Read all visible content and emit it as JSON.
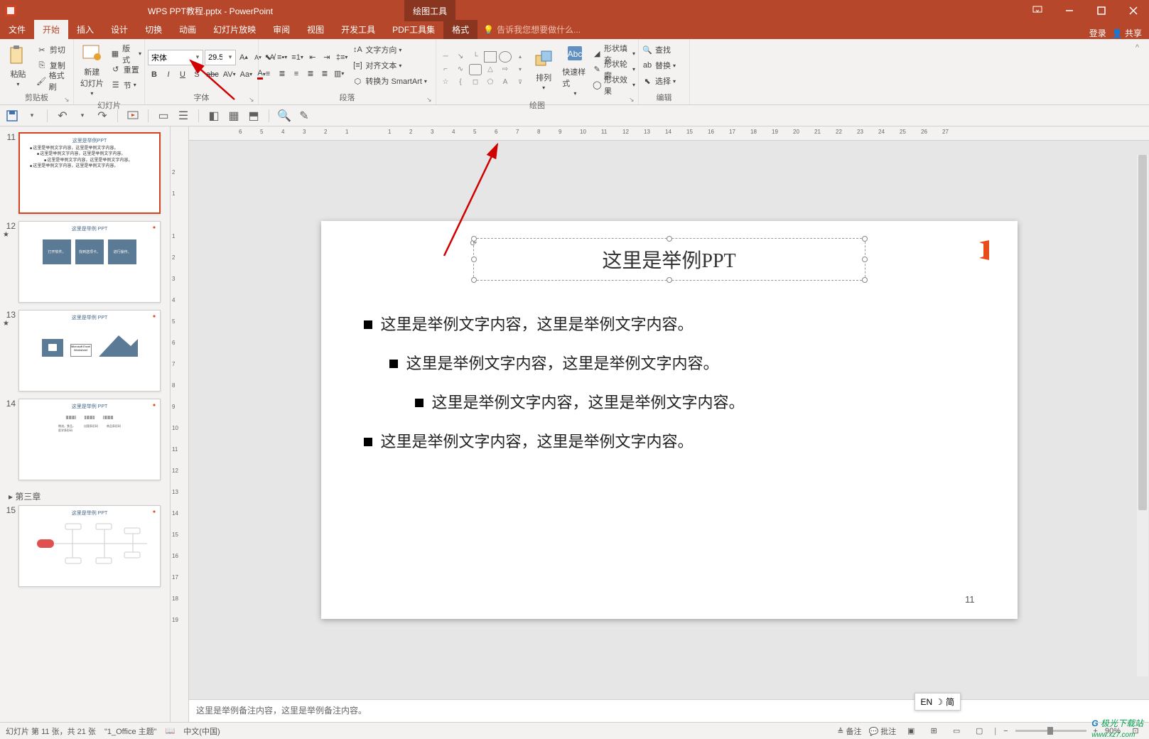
{
  "titlebar": {
    "title": "WPS PPT教程.pptx - PowerPoint",
    "drawing_tools": "绘图工具"
  },
  "menu": {
    "file": "文件",
    "home": "开始",
    "insert": "插入",
    "design": "设计",
    "transition": "切换",
    "animation": "动画",
    "slideshow": "幻灯片放映",
    "review": "审阅",
    "view": "视图",
    "dev": "开发工具",
    "pdf": "PDF工具集",
    "format": "格式",
    "tellme": "告诉我您想要做什么...",
    "login": "登录",
    "share": "共享"
  },
  "ribbon": {
    "clipboard": {
      "paste": "粘贴",
      "cut": "剪切",
      "copy": "复制",
      "fmt": "格式刷",
      "label": "剪贴板"
    },
    "slides": {
      "new": "新建\n幻灯片",
      "layout": "版式",
      "reset": "重置",
      "section": "节",
      "label": "幻灯片"
    },
    "font": {
      "name": "宋体",
      "size": "29.5",
      "label": "字体"
    },
    "para": {
      "label": "段落",
      "textdir": "文字方向",
      "align": "对齐文本",
      "smart": "转换为 SmartArt"
    },
    "draw": {
      "arrange": "排列",
      "quick": "快速样式",
      "fill": "形状填充",
      "outline": "形状轮廓",
      "effect": "形状效果",
      "label": "绘图"
    },
    "edit": {
      "find": "查找",
      "replace": "替换",
      "select": "选择",
      "label": "编辑"
    }
  },
  "thumbs": {
    "t11": {
      "num": "11",
      "title": "这里是举例PPT",
      "lines": [
        "这里是举例文字内容，这里是举例文字内容。",
        "这里是举例文字内容，这里是举例文字内容。",
        "这里是举例文字内容，这里是举例文字内容。",
        "这里是举例文字内容，这里是举例文字内容。"
      ]
    },
    "t12": {
      "num": "12",
      "title": "这里是举例 PPT",
      "b1": "打开软件。",
      "b2": "找到选项卡。",
      "b3": "进行操作。"
    },
    "t13": {
      "num": "13",
      "title": "这里是举例 PPT"
    },
    "t14": {
      "num": "14",
      "title": "这里是举例 PPT"
    },
    "section": "第三章",
    "t15": {
      "num": "15",
      "title": "这里是举例 PPT"
    }
  },
  "slide": {
    "title": "这里是举例PPT",
    "bullets": [
      "这里是举例文字内容，这里是举例文字内容。",
      "这里是举例文字内容，这里是举例文字内容。",
      "这里是举例文字内容，这里是举例文字内容。",
      "这里是举例文字内容，这里是举例文字内容。"
    ],
    "number": "11"
  },
  "notes": "这里是举例备注内容，这里是举例备注内容。",
  "status": {
    "slide": "幻灯片 第 11 张，共 21 张",
    "theme": "\"1_Office 主题\"",
    "lang": "中文(中国)",
    "notes": "备注",
    "comments": "批注",
    "zoom": "90%"
  },
  "ime": {
    "en": "EN",
    "sym": "简"
  },
  "watermark": {
    "brand": "极光下载站",
    "url": "www.xz7.com"
  }
}
